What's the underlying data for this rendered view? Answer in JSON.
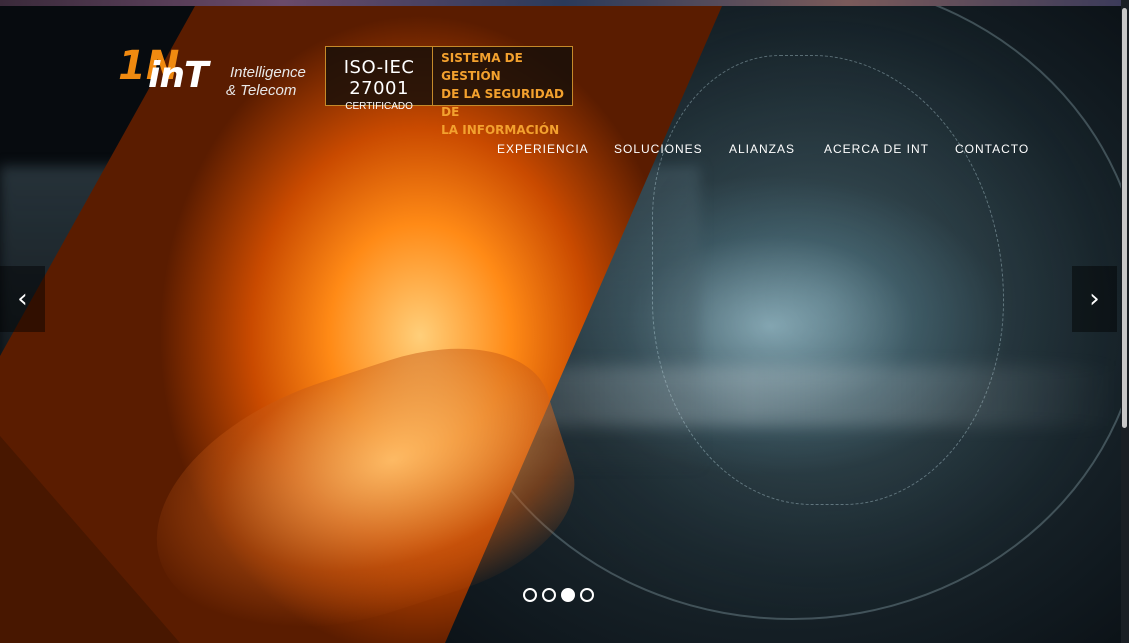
{
  "brand": {
    "mark": "1N",
    "name": "inT",
    "tagline_line1": "Intelligence",
    "tagline_line2": "& Telecom"
  },
  "certification": {
    "code": "ISO-IEC 27001",
    "status": "CERTIFICADO",
    "line1": "SISTEMA DE GESTIÓN",
    "line2": "DE LA SEGURIDAD DE",
    "line3": "LA INFORMACIÓN"
  },
  "nav": {
    "items": [
      {
        "label": "EXPERIENCIA"
      },
      {
        "label": "SOLUCIONES"
      },
      {
        "label": "ALIANZAS"
      },
      {
        "label": "ACERCA DE INT"
      },
      {
        "label": "CONTACTO"
      }
    ]
  },
  "slider": {
    "prev_icon": "‹",
    "next_icon": "›",
    "total_slides": 4,
    "active_slide": 3
  },
  "colors": {
    "accent": "#f08a10",
    "nav_text": "#ffffff"
  }
}
